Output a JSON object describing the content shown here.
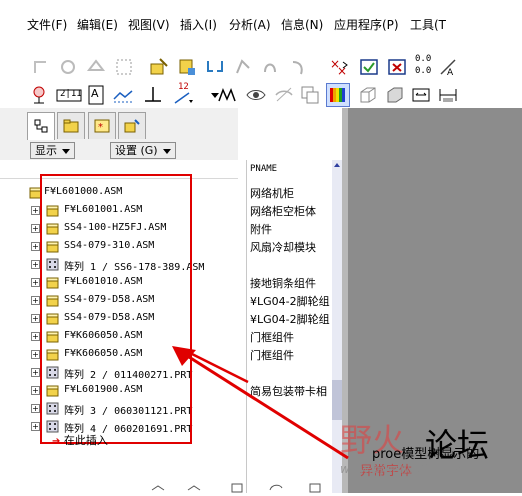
{
  "menu": {
    "items": [
      {
        "label": "文件(F)"
      },
      {
        "label": "编辑(E)"
      },
      {
        "label": "视图(V)"
      },
      {
        "label": "插入(I)"
      },
      {
        "label": "分析(A)"
      },
      {
        "label": "信息(N)"
      },
      {
        "label": "应用程序(P)"
      },
      {
        "label": "工具(T"
      }
    ]
  },
  "toolbar2": {
    "badge_label": "2|11",
    "num_label": "12"
  },
  "toolbar1": {
    "num_top": "0.0",
    "num_bottom": "0.0"
  },
  "panel": {
    "show_label": "显示",
    "settings_label": "设置 (G)"
  },
  "tree": {
    "column_header": "PNAME",
    "rows": [
      {
        "label": "F¥L601000.ASM",
        "param": "网络机柜"
      },
      {
        "label": "F¥L601001.ASM",
        "param": "网络柜空柜体"
      },
      {
        "label": "SS4-100-HZ5FJ.ASM",
        "param": "附件"
      },
      {
        "label": "SS4-079-310.ASM",
        "param": "风扇冷却模块"
      },
      {
        "label": "阵列 1 / SS6-178-389.ASM",
        "param": ""
      },
      {
        "label": "F¥L601010.ASM",
        "param": "接地铜条组件"
      },
      {
        "label": "SS4-079-D58.ASM",
        "param": "¥LG04-2脚轮组"
      },
      {
        "label": "SS4-079-D58.ASM",
        "param": "¥LG04-2脚轮组"
      },
      {
        "label": "F¥K606050.ASM",
        "param": "门框组件"
      },
      {
        "label": "F¥K606050.ASM",
        "param": "门框组件"
      },
      {
        "label": "阵列 2 / 011400271.PRT",
        "param": ""
      },
      {
        "label": "F¥L601900.ASM",
        "param": "简易包装带卡相"
      },
      {
        "label": "阵列 3 / 060301121.PRT",
        "param": ""
      },
      {
        "label": "阵列 4 / 060201691.PRT",
        "param": ""
      }
    ],
    "insert_here": "在此插入"
  },
  "watermark": {
    "brand_cn": "野火",
    "brand_lt": "论坛",
    "note_line1": "proe模型树显示的",
    "note_line2": "异常字体",
    "url": "www.proewildfire.cn"
  },
  "colors": {
    "annotation_red": "#e00000",
    "viewport_gray": "#8c8c8c",
    "folder_yellow": "#f2d24a",
    "pattern_gray": "#d9d9e8"
  }
}
